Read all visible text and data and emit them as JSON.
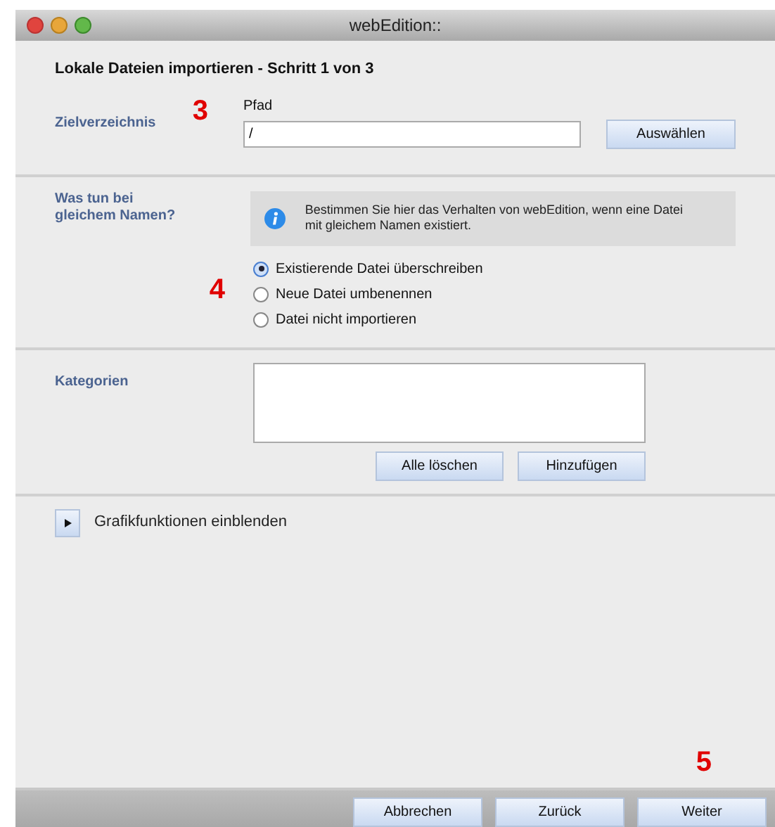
{
  "window": {
    "title": "webEdition::"
  },
  "heading": "Lokale Dateien importieren - Schritt 1 von 3",
  "target": {
    "label": "Zielverzeichnis",
    "marker": "3",
    "field_label": "Pfad",
    "value": "/",
    "button": "Auswählen"
  },
  "conflict": {
    "label": "Was tun bei gleichem Namen?",
    "info": "Bestimmen Sie hier das Verhalten von webEdition, wenn eine Datei mit gleichem Namen existiert.",
    "marker": "4",
    "options": [
      {
        "label": "Existierende Datei überschreiben",
        "selected": true
      },
      {
        "label": "Neue Datei umbenennen",
        "selected": false
      },
      {
        "label": "Datei nicht importieren",
        "selected": false
      }
    ]
  },
  "categories": {
    "label": "Kategorien",
    "buttons": [
      "Alle löschen",
      "Hinzufügen"
    ]
  },
  "toggle": {
    "label": "Grafikfunktionen einblenden",
    "expanded": false
  },
  "footer": {
    "marker": "5",
    "buttons": [
      "Abbrechen",
      "Zurück",
      "Weiter"
    ]
  }
}
